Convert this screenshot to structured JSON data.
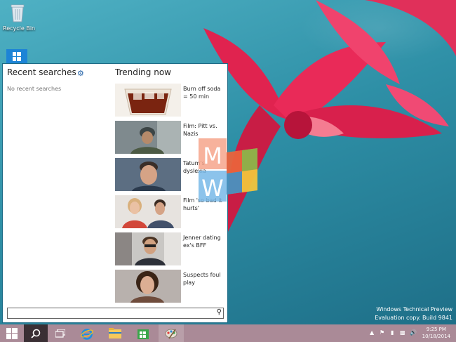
{
  "desktop": {
    "recycle_bin_label": "Recycle Bin"
  },
  "search_panel": {
    "recent_title": "Recent searches",
    "no_recent": "No recent searches",
    "trending_title": "Trending now",
    "search_placeholder": "",
    "trending": [
      {
        "text": "Burn off soda = 50 min",
        "icon": "soda-thumbnail"
      },
      {
        "text": "Film: Pitt vs. Nazis",
        "icon": "film-thumbnail"
      },
      {
        "text": "Tatum's dyslexia",
        "icon": "portrait-thumbnail"
      },
      {
        "text": "Film 'so bad it hurts'",
        "icon": "couple-thumbnail"
      },
      {
        "text": "Jenner dating ex's BFF",
        "icon": "man-thumbnail"
      },
      {
        "text": "Suspects foul play",
        "icon": "woman-thumbnail"
      }
    ]
  },
  "watermark": {
    "line1": "Windows Technical Preview",
    "line2": "Evaluation copy. Build 9841"
  },
  "logo": {
    "letter1": "M",
    "letter2": "W"
  },
  "clock": {
    "time": "9:25 PM",
    "date": "10/18/2014"
  },
  "colors": {
    "taskbar": "#aa8a97",
    "accent": "#1f5fa5",
    "desktop": "#2e8fa6"
  }
}
